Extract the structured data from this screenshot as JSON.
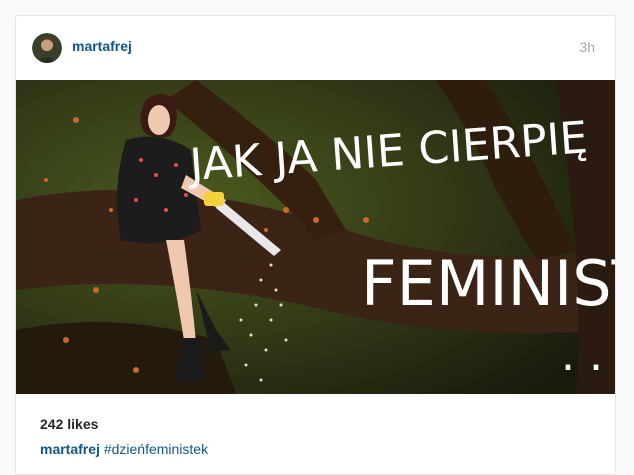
{
  "post": {
    "username": "martafrej",
    "time": "3h",
    "image": {
      "text_line1": "JAK JA NIE CIERPIĘ",
      "text_line2": "FEMINISTEK",
      "dots": ". ."
    },
    "likes": "242 likes",
    "caption": {
      "username": "martafrej",
      "hashtag": "#dzieńfeministek"
    }
  },
  "colors": {
    "link": "#125688",
    "muted": "#a5a7aa"
  }
}
